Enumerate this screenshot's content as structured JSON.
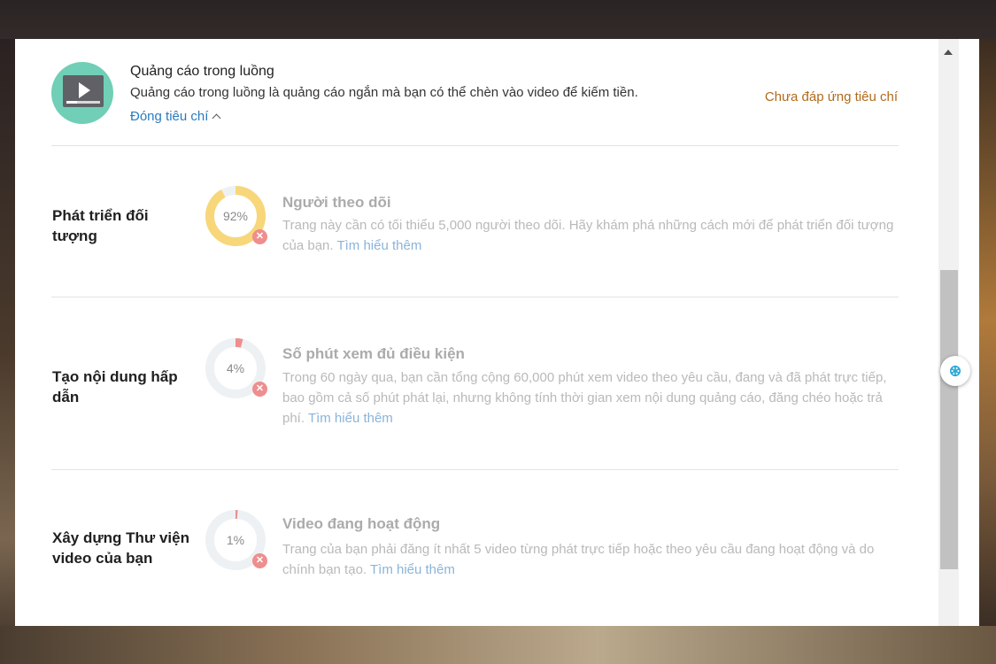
{
  "header": {
    "title": "Quảng cáo trong luồng",
    "description": "Quảng cáo trong luồng là quảng cáo ngắn mà bạn có thể chèn vào video để kiếm tiền.",
    "toggle_label": "Đóng tiêu chí",
    "status": "Chưa đáp ứng tiêu chí",
    "icon": "video-play-icon"
  },
  "criteria": [
    {
      "category": "Phát triển đối tượng",
      "progress_label": "92%",
      "progress": 0.92,
      "ring_color": "#f7d77a",
      "title": "Người theo dõi",
      "description": "Trang này cần có tối thiểu 5,000 người theo dõi. Hãy khám phá những cách mới để phát triển đối tượng của bạn.",
      "link": "Tìm hiểu thêm"
    },
    {
      "category": "Tạo nội dung hấp dẫn",
      "progress_label": "4%",
      "progress": 0.04,
      "ring_color": "#ee8e8e",
      "title": "Số phút xem đủ điều kiện",
      "description": "Trong 60 ngày qua, bạn cần tổng cộng 60,000 phút xem video theo yêu cầu, đang và đã phát trực tiếp, bao gồm cả số phút phát lại, nhưng không tính thời gian xem nội dung quảng cáo, đăng chéo hoặc trả phí.",
      "link": "Tìm hiểu thêm"
    },
    {
      "category": "Xây dựng Thư viện video của bạn",
      "progress_label": "1%",
      "progress": 0.01,
      "ring_color": "#ee8e8e",
      "title": "Video đang hoạt động",
      "description": "Trang của bạn phải đăng ít nhất 5 video từng phát trực tiếp hoặc theo yêu cầu đang hoạt động và do chính bạn tạo.",
      "link": "Tìm hiểu thêm"
    }
  ],
  "colors": {
    "ring_track": "#eef1f4",
    "status": "#b26a1c",
    "link": "#2a7bc0",
    "icon_bg": "#70cfb6",
    "error_badge": "#ee8e8e"
  }
}
